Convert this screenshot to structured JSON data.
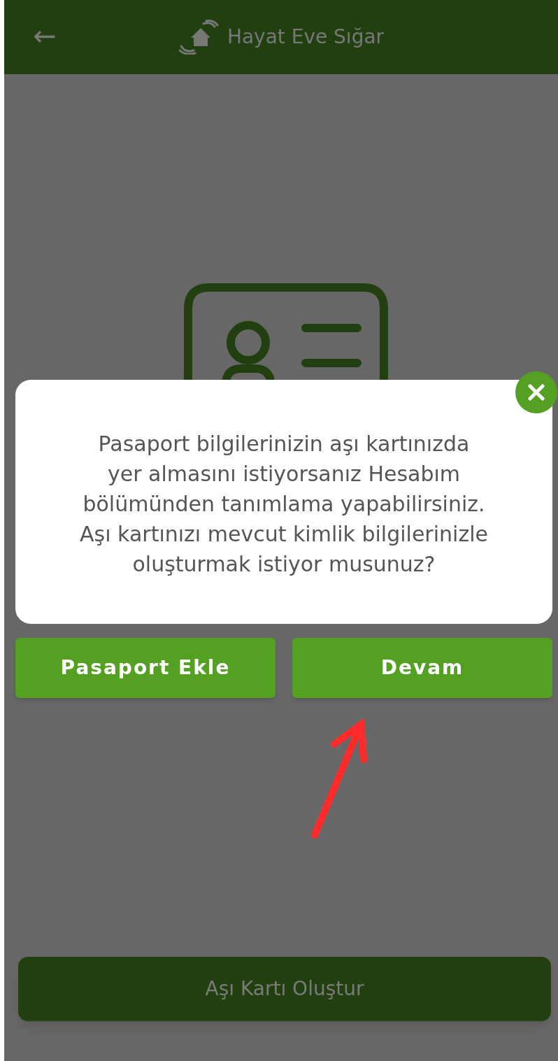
{
  "header": {
    "back": "←",
    "title": "Hayat Eve Sığar"
  },
  "dialog": {
    "message": "Pasaport bilgilerinizin aşı kartınızda\nyer almasını istiyorsanız Hesabım\nbölümünden tanımlama yapabilirsiniz.\nAşı kartınızı mevcut kimlik bilgilerinizle\noluşturmak istiyor musunuz?",
    "buttons": [
      "Pasaport Ekle",
      "Devam"
    ]
  },
  "primary_button": {
    "label": "Aşı Kartı Oluştur",
    "disabled": true
  }
}
